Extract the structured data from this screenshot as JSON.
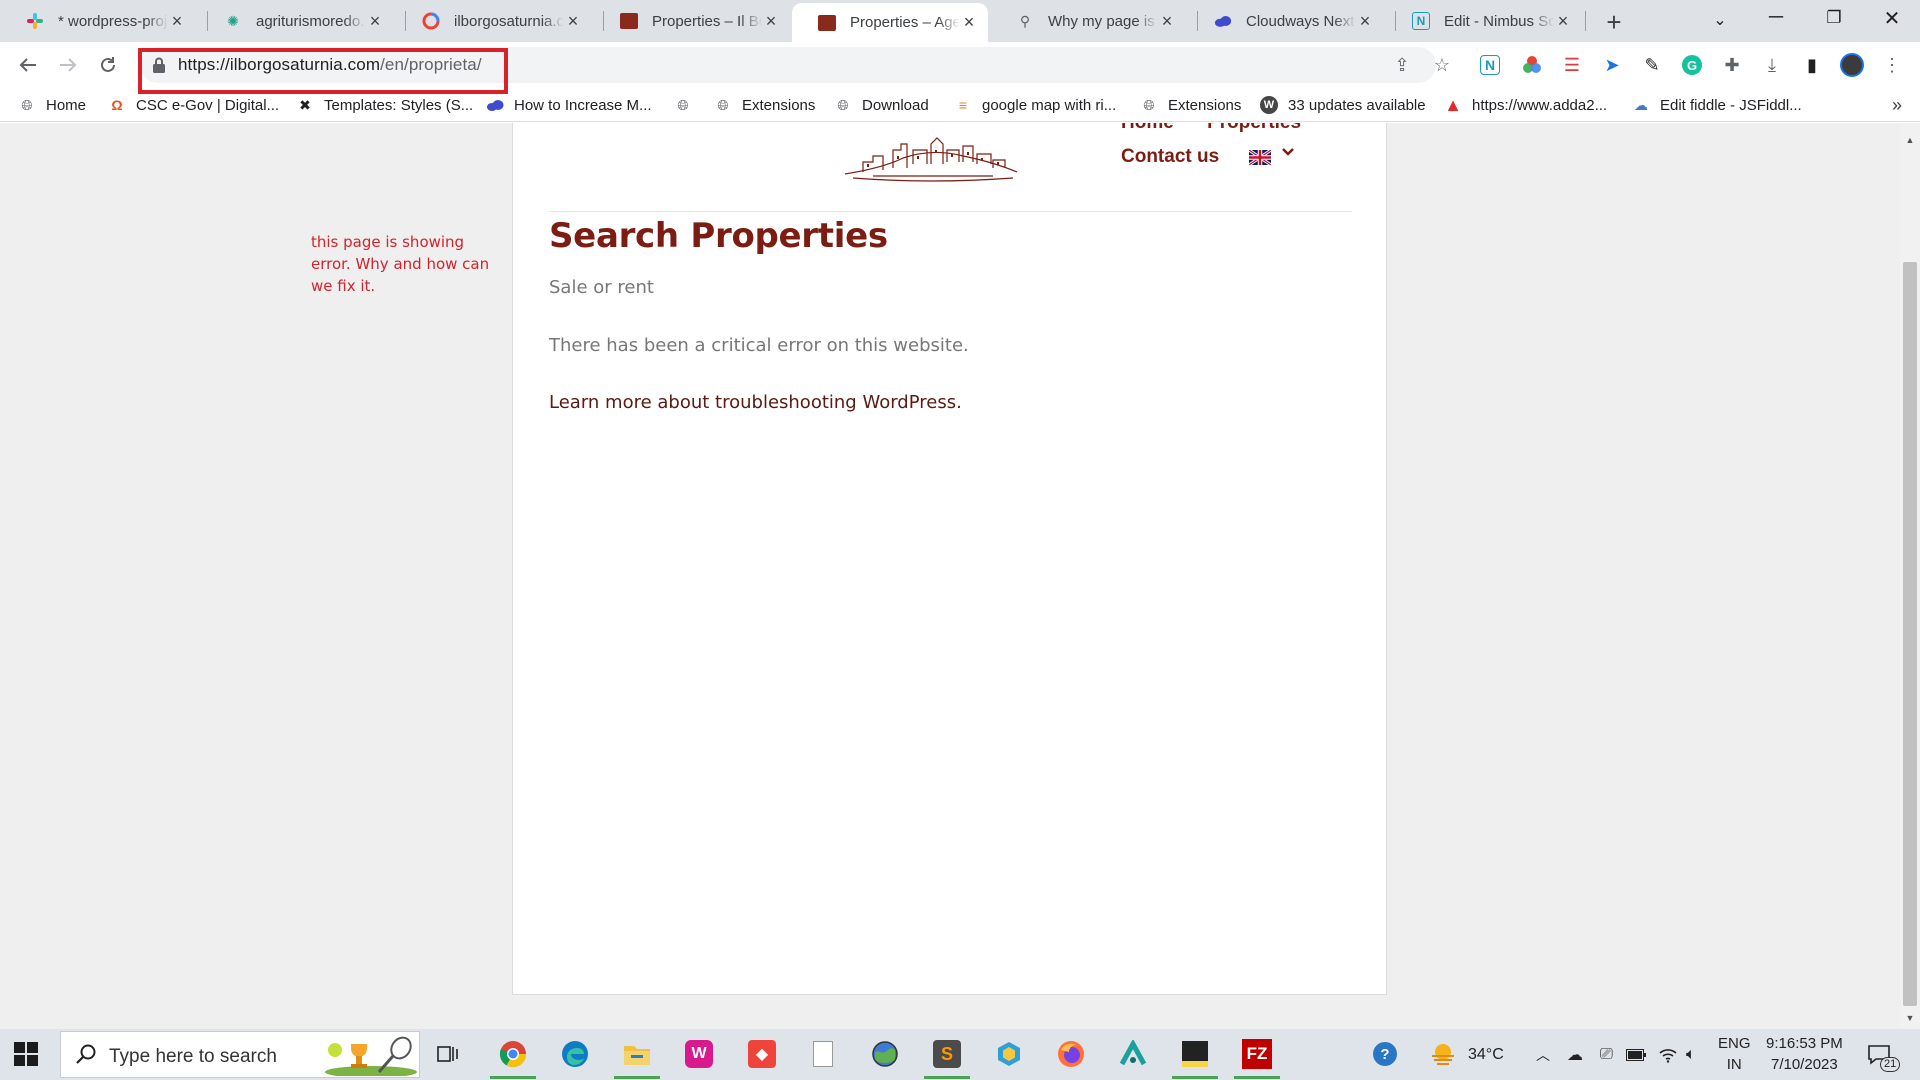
{
  "tabs": [
    {
      "title": "* wordpress-proje",
      "icon": "slack-icon"
    },
    {
      "title": "agriturismoredo.it",
      "icon": "gear-icon"
    },
    {
      "title": "ilborgosaturnia.co",
      "icon": "google-icon"
    },
    {
      "title": "Properties – Il Bor",
      "icon": "site-icon"
    },
    {
      "title": "Properties – Agen",
      "icon": "site-icon",
      "active": true
    },
    {
      "title": "Why my page is s",
      "icon": "search-icon"
    },
    {
      "title": "Cloudways Next-G",
      "icon": "cloud-icon"
    },
    {
      "title": "Edit - Nimbus Scr",
      "icon": "nimbus-icon"
    }
  ],
  "address_bar": {
    "host": "https://ilborgosaturnia.com",
    "path": "/en/proprieta/"
  },
  "bookmarks": [
    "Home",
    "CSC e-Gov | Digital...",
    "Templates: Styles (S...",
    "How to Increase M...",
    "",
    "Extensions",
    "Download",
    "google map with ri...",
    "Extensions",
    "33 updates available",
    "https://www.adda2...",
    "Edit fiddle - JSFiddl..."
  ],
  "annotation": "this page is showing error. Why and how can we fix it.",
  "site": {
    "nav_home": "Home",
    "nav_properties": "Properties",
    "nav_contact": "Contact us",
    "language": "English flag"
  },
  "page": {
    "title": "Search Properties",
    "subtitle": "Sale or rent",
    "error_message": "There has been a critical error on this website.",
    "help_link": "Learn more about troubleshooting WordPress."
  },
  "taskbar": {
    "search_placeholder": "Type here to search",
    "weather": "34°C",
    "lang_line1": "ENG",
    "lang_line2": "IN",
    "time": "9:16:53 PM",
    "date": "7/10/2023",
    "notifications": "21"
  },
  "colors": {
    "brand": "#7b1d12",
    "annotation_red": "#d2232a",
    "highlight_box": "#d7222b"
  }
}
